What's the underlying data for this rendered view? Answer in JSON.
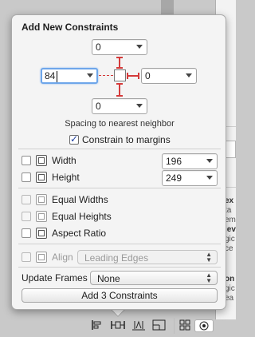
{
  "popover": {
    "title": "Add New Constraints",
    "spacing_top": "0",
    "spacing_left": "84",
    "spacing_right": "0",
    "spacing_bottom": "0",
    "spacing_caption": "Spacing to nearest neighbor",
    "constrain_margins_label": "Constrain to margins",
    "constrain_margins_checked": true,
    "width_label": "Width",
    "width_value": "196",
    "height_label": "Height",
    "height_value": "249",
    "equal_widths_label": "Equal Widths",
    "equal_heights_label": "Equal Heights",
    "aspect_ratio_label": "Aspect Ratio",
    "align_label": "Align",
    "align_value": "Leading Edges",
    "update_frames_label": "Update Frames",
    "update_frames_value": "None",
    "add_button_label": "Add 3 Constraints"
  },
  "colors": {
    "accent_focus": "#6ea6ea",
    "constraint_red": "#d43a3a",
    "checkmark_blue": "#1e3fa0"
  },
  "background_fragments": [
    {
      "text": "ex",
      "bold": true
    },
    {
      "text": "ta"
    },
    {
      "text": "em"
    },
    {
      "text": "iev",
      "bold": true
    },
    {
      "text": "gic"
    },
    {
      "text": "ce"
    },
    {
      "text": "on",
      "bold": true
    },
    {
      "text": "gic"
    },
    {
      "text": "ea"
    }
  ],
  "toolbar": {
    "icons": [
      "align-icon",
      "pin-icon",
      "resolve-issues-icon",
      "resizing-behavior-icon",
      "grid-icon",
      "target-icon"
    ]
  }
}
